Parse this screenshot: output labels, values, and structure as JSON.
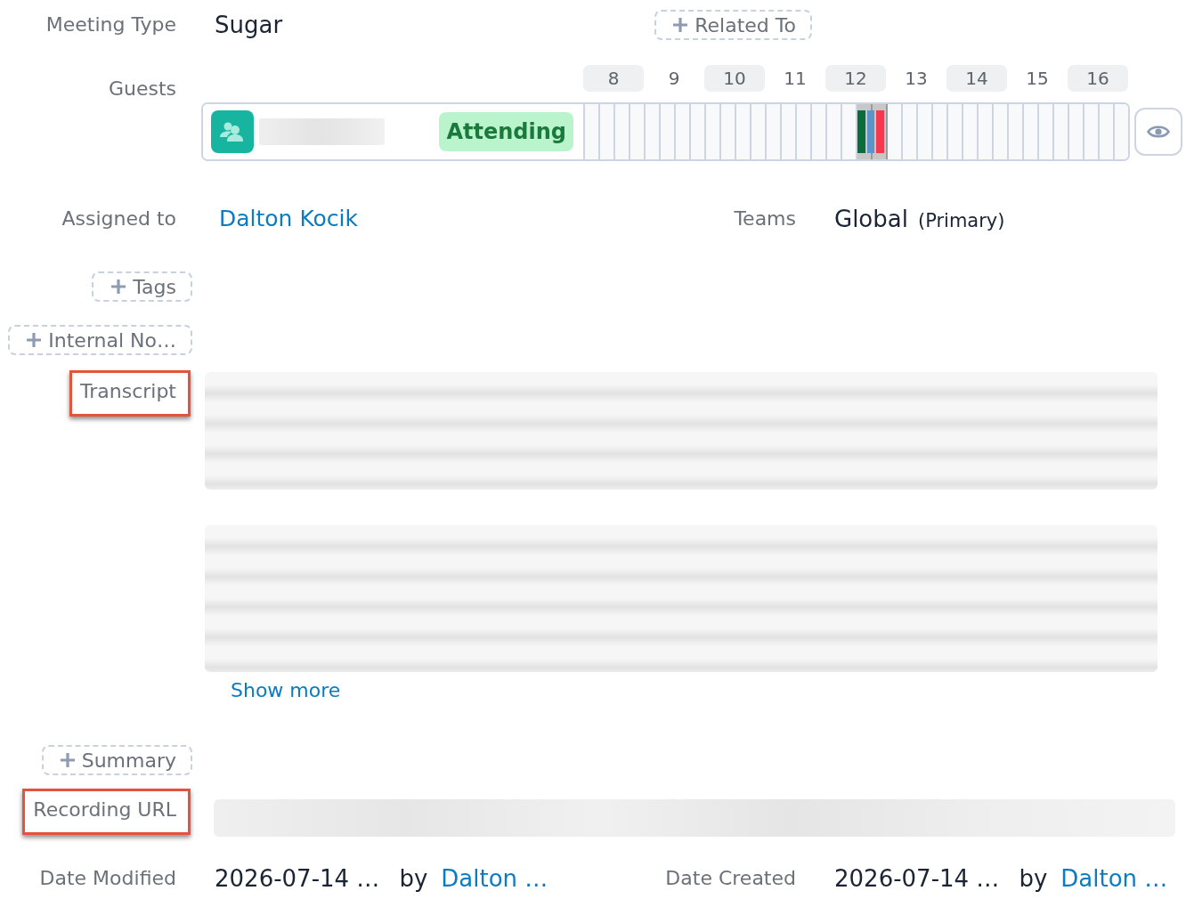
{
  "meeting_type": {
    "label": "Meeting Type",
    "value": "Sugar"
  },
  "related_to_button": {
    "label": "Related To"
  },
  "guests": {
    "label": "Guests",
    "hours": [
      "8",
      "9",
      "10",
      "11",
      "12",
      "13",
      "14",
      "15",
      "16"
    ],
    "slots": [
      {
        "selected": false
      },
      {
        "selected": false
      },
      {
        "selected": false
      },
      {
        "selected": false
      },
      {
        "selected": false
      },
      {
        "selected": false
      },
      {
        "selected": false
      },
      {
        "selected": false
      },
      {
        "selected": false
      },
      {
        "selected": false
      },
      {
        "selected": false
      },
      {
        "selected": false
      },
      {
        "selected": false
      },
      {
        "selected": false
      },
      {
        "selected": false
      },
      {
        "selected": false
      },
      {
        "selected": false
      },
      {
        "selected": false
      },
      {
        "selected": true
      },
      {
        "selected": true
      },
      {
        "selected": false
      },
      {
        "selected": false
      },
      {
        "selected": false
      },
      {
        "selected": false
      },
      {
        "selected": false
      },
      {
        "selected": false
      },
      {
        "selected": false
      },
      {
        "selected": false
      },
      {
        "selected": false
      },
      {
        "selected": false
      },
      {
        "selected": false
      },
      {
        "selected": false
      },
      {
        "selected": false
      },
      {
        "selected": false
      },
      {
        "selected": false
      },
      {
        "selected": false
      }
    ],
    "guest_list": [
      {
        "status": "Attending",
        "marks": [
          {
            "color": "#0b6b3a"
          },
          {
            "color": "#5b94c9"
          },
          {
            "color": "#f5374f"
          }
        ]
      }
    ]
  },
  "assigned_to": {
    "label": "Assigned to",
    "value": "Dalton Kocik"
  },
  "teams": {
    "label": "Teams",
    "value": "Global",
    "note": "(Primary)"
  },
  "tags_button": {
    "label": "Tags"
  },
  "internal_button": {
    "label": "Internal No…"
  },
  "transcript": {
    "label": "Transcript",
    "highlighted": true,
    "link": "Show more"
  },
  "summary_button": {
    "label": "Summary"
  },
  "recording_url": {
    "label": "Recording URL",
    "highlighted": true
  },
  "date_modified": {
    "label": "Date Modified",
    "value": "2026-07-14 …",
    "by": "by",
    "user": "Dalton …"
  },
  "date_created": {
    "label": "Date Created",
    "value": "2026-07-14 …",
    "by": "by",
    "user": "Dalton …"
  }
}
